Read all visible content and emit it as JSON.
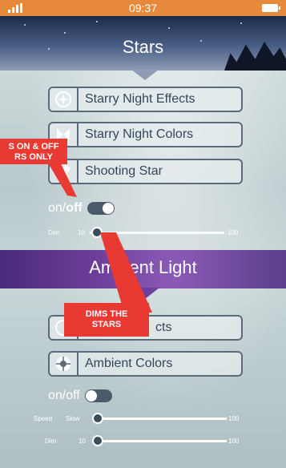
{
  "status_bar": {
    "time": "09:37"
  },
  "stars_section": {
    "title": "Stars",
    "buttons": [
      {
        "label": "Starry Night Effects",
        "icon": "compass-icon"
      },
      {
        "label": "Starry Night Colors",
        "icon": "bowtie-icon"
      },
      {
        "label": "Shooting Star",
        "icon": "heart-icon"
      }
    ],
    "toggle": {
      "on_label": "on/",
      "off_label": "off",
      "state": "on"
    },
    "dim_slider": {
      "label": "Dim",
      "min_label": "10",
      "max_label": "100",
      "value": 10
    }
  },
  "ambient_section": {
    "title": "Ambient Light",
    "buttons": [
      {
        "label": "cts",
        "icon": "circle-icon"
      },
      {
        "label": "Ambient Colors",
        "icon": "color-wheel-icon"
      }
    ],
    "toggle": {
      "label": "on/off",
      "state": "off"
    },
    "speed_slider": {
      "label": "Speed",
      "min_label": "Slow",
      "max_label": "100",
      "value": 0
    },
    "dim_slider": {
      "label": "Dim",
      "min_label": "10",
      "max_label": "100",
      "value": 10
    }
  },
  "callouts": {
    "toggle_note": {
      "line1": "S ON & OFF",
      "line2": "RS ONLY"
    },
    "dim_note": {
      "line1": "DIMS THE",
      "line2": "STARS"
    }
  },
  "colors": {
    "status_bar": "#e6893b",
    "callout": "#e83a33",
    "button_border": "#5c6b7a"
  }
}
